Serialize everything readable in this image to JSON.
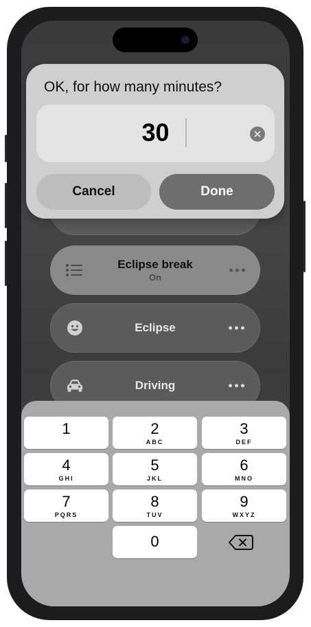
{
  "dialog": {
    "title": "OK, for how many minutes?",
    "value": "30",
    "cancel_label": "Cancel",
    "done_label": "Done"
  },
  "focus_list": [
    {
      "name": "Eclipse break",
      "status": "On",
      "icon": "list-icon"
    },
    {
      "name": "Eclipse",
      "icon": "smiley-face-icon"
    },
    {
      "name": "Driving",
      "icon": "car-icon"
    }
  ],
  "keypad": {
    "keys": [
      {
        "digit": "1",
        "letters": ""
      },
      {
        "digit": "2",
        "letters": "ABC"
      },
      {
        "digit": "3",
        "letters": "DEF"
      },
      {
        "digit": "4",
        "letters": "GHI"
      },
      {
        "digit": "5",
        "letters": "JKL"
      },
      {
        "digit": "6",
        "letters": "MNO"
      },
      {
        "digit": "7",
        "letters": "PQRS"
      },
      {
        "digit": "8",
        "letters": "TUV"
      },
      {
        "digit": "9",
        "letters": "WXYZ"
      },
      {
        "digit": "0",
        "letters": ""
      }
    ],
    "backspace_icon": "backspace-icon"
  },
  "colors": {
    "phone_frame": "#1c1c1e",
    "done_button": "#6e6e6e",
    "cancel_button": "#bdbdbd"
  }
}
